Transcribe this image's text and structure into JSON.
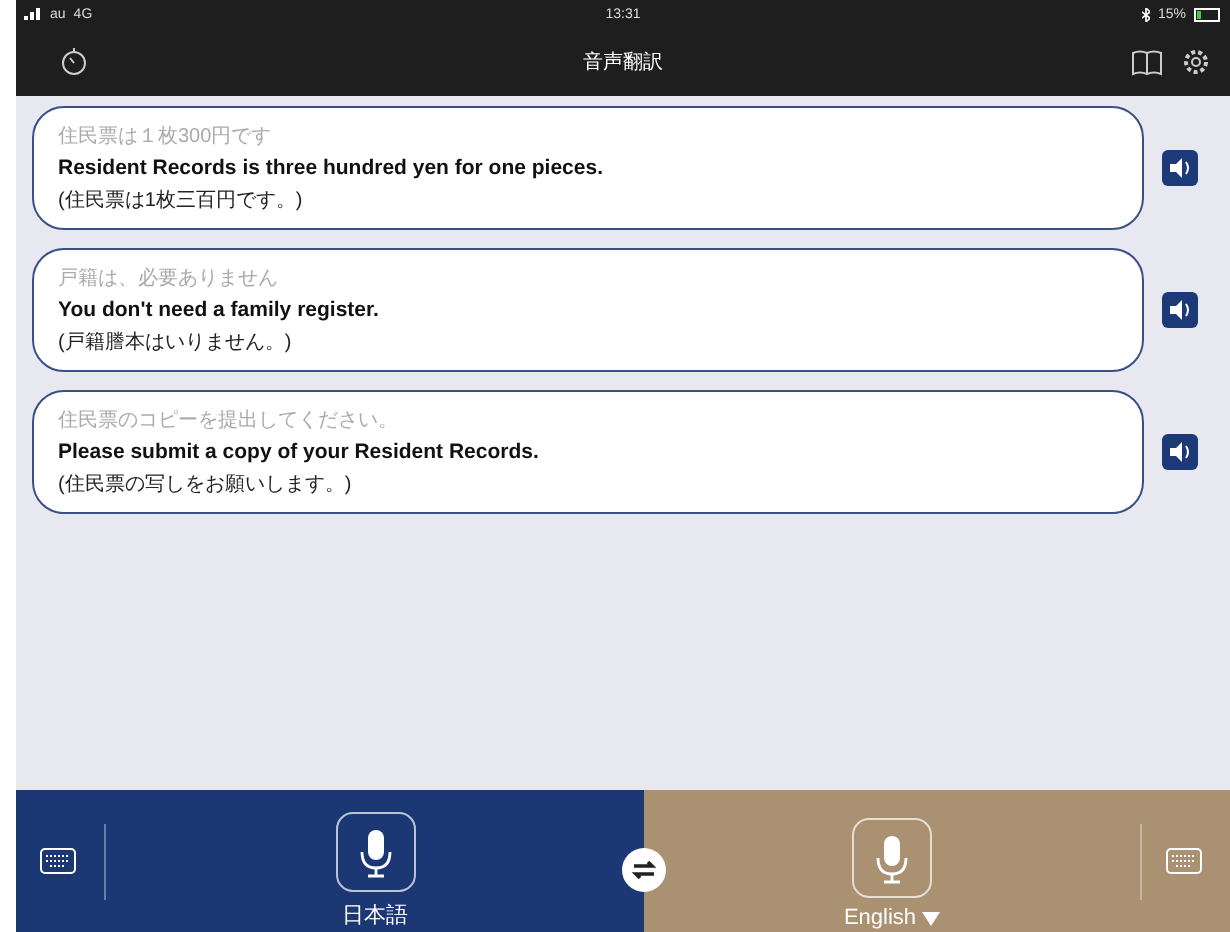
{
  "status_bar": {
    "carrier": "au",
    "network": "4G",
    "time": "13:31",
    "battery": "15%"
  },
  "nav": {
    "title": "音声翻訳"
  },
  "messages": [
    {
      "source": "住民票は１枚300円です",
      "translation": "Resident Records is three hundred yen for one pieces.",
      "back_translation": "(住民票は1枚三百円です。)"
    },
    {
      "source": "戸籍は、必要ありません",
      "translation": "You don't need a family register.",
      "back_translation": "(戸籍謄本はいりません。)"
    },
    {
      "source": "住民票のコピーを提出してください。",
      "translation": "Please submit a copy of your Resident Records.",
      "back_translation": "(住民票の写しをお願いします。)"
    }
  ],
  "languages": [
    {
      "label": "日本語",
      "dropdown": false
    },
    {
      "label": "English",
      "dropdown": true
    }
  ]
}
